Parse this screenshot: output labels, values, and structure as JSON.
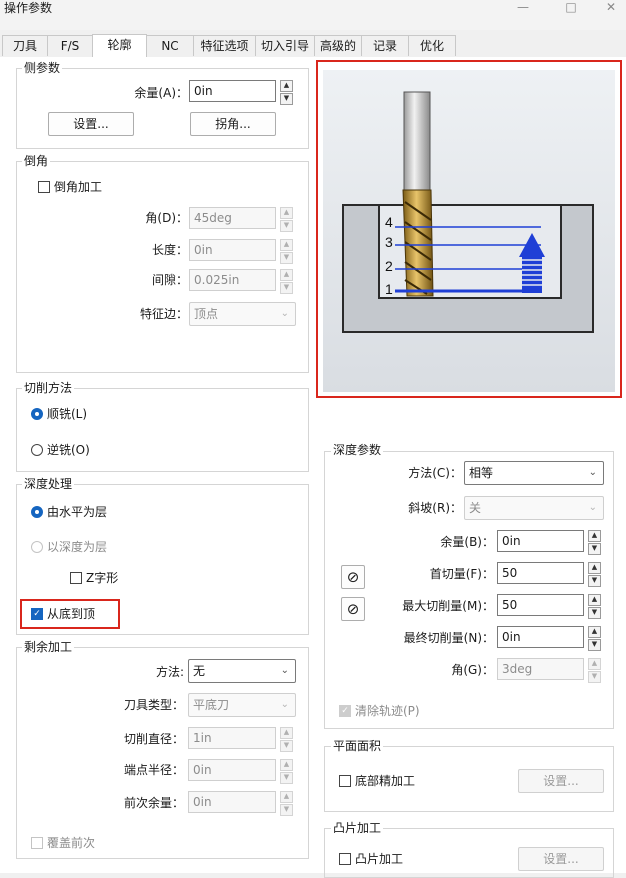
{
  "window": {
    "title": "操作参数"
  },
  "tabs": [
    "刀具",
    "F/S",
    "轮廓",
    "NC",
    "特征选项",
    "切入引导",
    "高级的",
    "记录",
    "优化"
  ],
  "side_params": {
    "title": "侧参数",
    "stock_label": "余量(A)：",
    "stock_value": "0in",
    "settings_button": "设置...",
    "corner_button": "拐角..."
  },
  "chamfer": {
    "title": "倒角",
    "enable_label": "倒角加工",
    "angle_label": "角(D)：",
    "angle_value": "45deg",
    "length_label": "长度：",
    "length_value": "0in",
    "gap_label": "间隙：",
    "gap_value": "0.025in",
    "edge_label": "特征边：",
    "edge_value": "顶点"
  },
  "cut_method": {
    "title": "切削方法",
    "climb_label": "顺铣(L)",
    "conventional_label": "逆铣(O)"
  },
  "depth_processing": {
    "title": "深度处理",
    "by_level_label": "由水平为层",
    "by_depth_label": "以深度为层",
    "zigzag_label": "Z字形",
    "bottom_up_label": "从底到顶"
  },
  "rest_machining": {
    "title": "剩余加工",
    "method_label": "方法:",
    "method_value": "无",
    "tool_type_label": "刀具类型：",
    "tool_type_value": "平底刀",
    "diameter_label": "切削直径：",
    "diameter_value": "1in",
    "radius_label": "端点半径：",
    "radius_value": "0in",
    "prev_stock_label": "前次余量：",
    "prev_stock_value": "0in",
    "override_label": "覆盖前次"
  },
  "preview": {
    "level_labels": [
      "4",
      "3",
      "2",
      "1"
    ]
  },
  "depth_params": {
    "title": "深度参数",
    "method_label": "方法(C)：",
    "method_value": "相等",
    "ramp_label": "斜坡(R)：",
    "ramp_value": "关",
    "stock_label": "余量(B)：",
    "stock_value": "0in",
    "first_cut_label": "首切量(F)：",
    "first_cut_value": "50",
    "max_cut_label": "最大切削量(M)：",
    "max_cut_value": "50",
    "final_cut_label": "最终切削量(N)：",
    "final_cut_value": "0in",
    "angle_label": "角(G)：",
    "angle_value": "3deg",
    "clear_path_label": "清除轨迹(P)"
  },
  "flat_area": {
    "title": "平面面积",
    "bottom_finish_label": "底部精加工",
    "settings_button": "设置..."
  },
  "boss": {
    "title": "凸片加工",
    "boss_label": "凸片加工",
    "settings_button": "设置..."
  },
  "colors": {
    "accent": "#1565c0",
    "highlight": "#d9261c",
    "path_blue": "#1f3fd6"
  }
}
